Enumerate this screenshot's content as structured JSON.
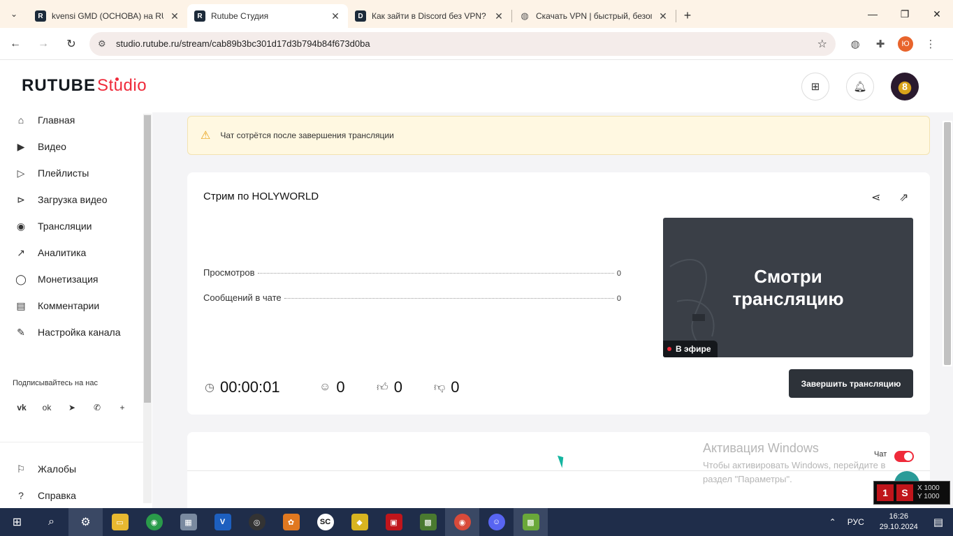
{
  "browser": {
    "tabs": [
      {
        "title": "kvensi GMD (ОСНОВА) на RUTU",
        "favicon": "R",
        "favicon_color": "#1c2a3a",
        "active": false
      },
      {
        "title": "Rutube Студия",
        "favicon": "R",
        "favicon_color": "#1c2a3a",
        "active": true
      },
      {
        "title": "Как зайти в Discord без VPN? ·",
        "favicon": "D",
        "favicon_color": "#1c2a3a",
        "active": false
      },
      {
        "title": "Скачать VPN | быстрый, безопа",
        "favicon": "globe",
        "favicon_color": "#666666",
        "active": false
      }
    ],
    "url": "studio.rutube.ru/stream/cab89b3bc301d17d3b794b84f673d0ba",
    "profile_initial": "Ю"
  },
  "header": {
    "logo_main": "RUTUBE",
    "logo_sub": "Studio"
  },
  "sidebar": {
    "items": [
      {
        "label": "Главная",
        "icon": "home-icon",
        "glyph": "⌂"
      },
      {
        "label": "Видео",
        "icon": "video-icon",
        "glyph": "▶"
      },
      {
        "label": "Плейлисты",
        "icon": "playlist-icon",
        "glyph": "▷"
      },
      {
        "label": "Загрузка видео",
        "icon": "upload-icon",
        "glyph": "⊳"
      },
      {
        "label": "Трансляции",
        "icon": "broadcast-icon",
        "glyph": "◉"
      },
      {
        "label": "Аналитика",
        "icon": "analytics-icon",
        "glyph": "↗"
      },
      {
        "label": "Монетизация",
        "icon": "monetization-icon",
        "glyph": "◯"
      },
      {
        "label": "Комментарии",
        "icon": "comments-icon",
        "glyph": "▤"
      },
      {
        "label": "Настройка канала",
        "icon": "settings-wand-icon",
        "glyph": "✎"
      }
    ],
    "follow_title": "Подписывайтесь на нас",
    "social": [
      {
        "name": "vk-icon",
        "glyph": "vk"
      },
      {
        "name": "ok-icon",
        "glyph": "ok"
      },
      {
        "name": "telegram-icon",
        "glyph": "➤"
      },
      {
        "name": "viber-icon",
        "glyph": "✆"
      },
      {
        "name": "plus-icon",
        "glyph": "+"
      }
    ],
    "bottom_items": [
      {
        "label": "Жалобы",
        "icon": "flag-icon",
        "glyph": "⚐"
      },
      {
        "label": "Справка",
        "icon": "help-icon",
        "glyph": "?"
      }
    ]
  },
  "notice": {
    "text": "Чат сотрётся после завершения трансляции"
  },
  "stream": {
    "title": "Стрим по HOLYWORLD",
    "stats": [
      {
        "label": "Просмотров",
        "value": "0"
      },
      {
        "label": "Сообщений в чате",
        "value": "0"
      }
    ],
    "preview_text_line1": "Смотри",
    "preview_text_line2": "трансляцию",
    "live_badge": "В эфире",
    "timer": "00:00:01",
    "viewers": "0",
    "likes": "0",
    "dislikes": "0",
    "end_button": "Завершить трансляцию"
  },
  "chat": {
    "label": "Чат",
    "enabled": true
  },
  "windows_watermark": {
    "title": "Активация Windows",
    "line1": "Чтобы активировать Windows, перейдите в",
    "line2": "раздел \"Параметры\"."
  },
  "overlay": {
    "x": "X 1000",
    "y": "Y 1000"
  },
  "taskbar": {
    "language": "РУС",
    "time": "16:26",
    "date": "29.10.2024"
  },
  "colors": {
    "brand_red": "#ef2a3a",
    "end_button": "#2d3239",
    "notice_bg": "#fff8e1",
    "taskbar": "#1f2d4a"
  }
}
